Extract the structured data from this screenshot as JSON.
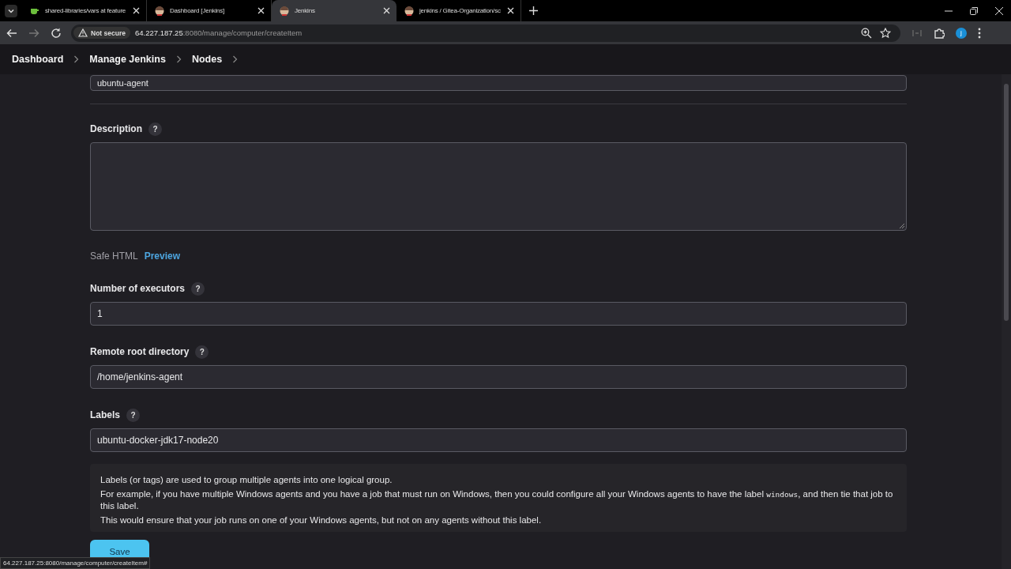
{
  "browser": {
    "tabs": [
      {
        "title": "shared-libraries/vars at feature",
        "selected": false
      },
      {
        "title": "Dashboard [Jenkins]",
        "selected": false
      },
      {
        "title": "Jenkins",
        "selected": true
      },
      {
        "title": "jenkins / Gitea-Organization/sc",
        "selected": false
      }
    ],
    "security": "Not secure",
    "url_host": "64.227.187.25",
    "url_path": ":8080/manage/computer/createItem",
    "profile_initial": "j"
  },
  "breadcrumbs": [
    "Dashboard",
    "Manage Jenkins",
    "Nodes"
  ],
  "name_field": {
    "value": "ubuntu-agent"
  },
  "description": {
    "label": "Description",
    "help": "?",
    "value_note": "Safe HTML",
    "preview": "Preview"
  },
  "fields": [
    {
      "label": "Number of executors",
      "help": "?",
      "value": "1"
    },
    {
      "label": "Remote root directory",
      "help": "?",
      "value": "/home/jenkins-agent"
    },
    {
      "label": "Labels",
      "help": "?",
      "value": "ubuntu-docker-jdk17-node20"
    }
  ],
  "labels_help": [
    {
      "text": "Labels (or tags) are used to group multiple agents into one logical group."
    },
    {
      "text": "For example, if you have multiple Windows agents and you have a job that must run on Windows, then you could configure all your Windows agents to have the label ",
      "code": "windows",
      "after": ", and then tie that job to this label."
    },
    {
      "text": "This would ensure that your job runs on one of your Windows agents, but not on any agents without this label."
    }
  ],
  "save": "Save",
  "status_url": "64.227.187.25:8080/manage/computer/createItem#"
}
